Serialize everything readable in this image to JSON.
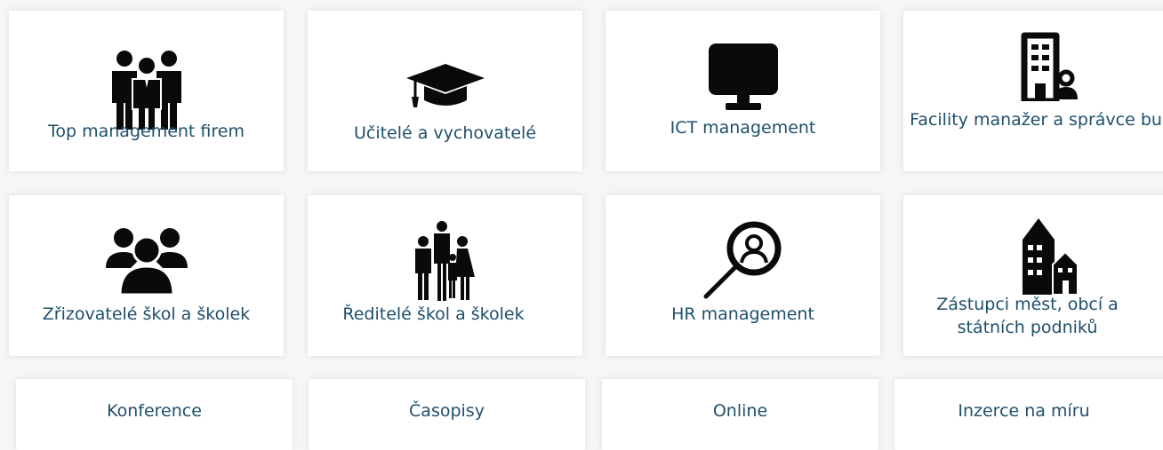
{
  "cards": [
    {
      "label": "Top management firem",
      "icon": "business-team-icon"
    },
    {
      "label": "Učitelé a vychovatelé",
      "icon": "graduation-cap-icon"
    },
    {
      "label": "ICT management",
      "icon": "monitor-icon"
    },
    {
      "label": "Facility manažer a správce budov",
      "icon": "building-manager-icon"
    },
    {
      "label": "Zřizovatelé škol a školek",
      "icon": "group-icon"
    },
    {
      "label": "Ředitelé škol a školek",
      "icon": "family-icon"
    },
    {
      "label": "HR management",
      "icon": "magnifier-person-icon"
    },
    {
      "label": "Zástupci měst, obcí a státních podniků",
      "icon": "city-buildings-icon"
    }
  ],
  "links": [
    {
      "label": "Konference"
    },
    {
      "label": "Časopisy"
    },
    {
      "label": "Online"
    },
    {
      "label": "Inzerce na míru"
    }
  ],
  "colors": {
    "label": "#1e4f6b",
    "icon": "#0a0a0a",
    "card": "#ffffff",
    "background": "#f6f6f6"
  }
}
